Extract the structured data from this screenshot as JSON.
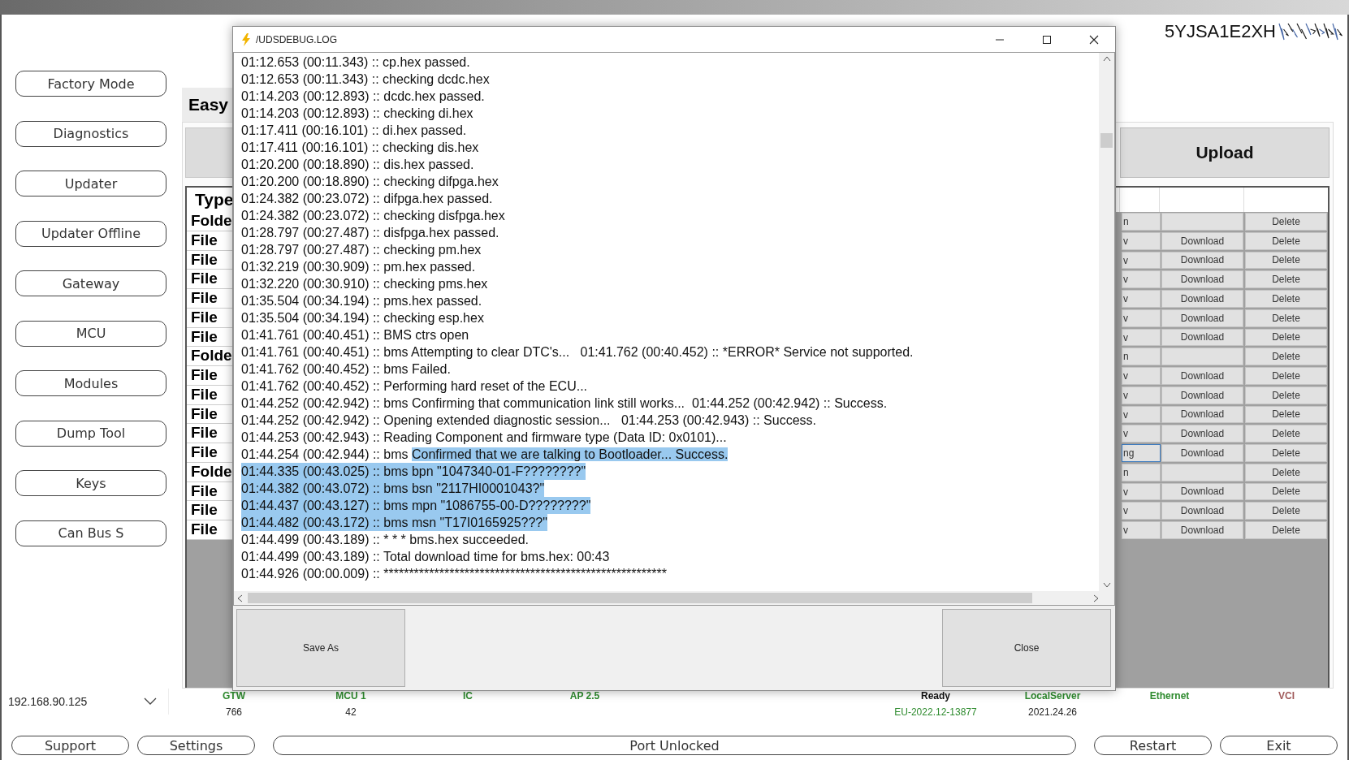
{
  "vin": "5YJSA1E2XH",
  "sidebar": {
    "buttons": [
      "Factory Mode",
      "Diagnostics",
      "Updater",
      "Updater Offline",
      "Gateway",
      "MCU",
      "Modules",
      "Dump Tool",
      "Keys",
      "Can Bus S"
    ]
  },
  "tab_label": "Easy",
  "upload_button": "Upload",
  "table": {
    "columns": [
      "Type"
    ],
    "rows": [
      {
        "column_1": "Folde",
        "column_2": "n",
        "column_4": "Delete",
        "selected": false
      },
      {
        "column_1": "File",
        "column_2": "v",
        "column_3": "Download",
        "column_4": "Delete",
        "selected": false
      },
      {
        "column_1": "File",
        "column_2": "v",
        "column_3": "Download",
        "column_4": "Delete",
        "selected": false
      },
      {
        "column_1": "File",
        "column_2": "v",
        "column_3": "Download",
        "column_4": "Delete",
        "selected": false
      },
      {
        "column_1": "File",
        "column_2": "v",
        "column_3": "Download",
        "column_4": "Delete",
        "selected": false
      },
      {
        "column_1": "File",
        "column_2": "v",
        "column_3": "Download",
        "column_4": "Delete",
        "selected": false
      },
      {
        "column_1": "File",
        "column_2": "v",
        "column_3": "Download",
        "column_4": "Delete",
        "selected": false
      },
      {
        "column_1": "Folde",
        "column_2": "n",
        "column_4": "Delete",
        "selected": false
      },
      {
        "column_1": "File",
        "column_2": "v",
        "column_3": "Download",
        "column_4": "Delete",
        "selected": false
      },
      {
        "column_1": "File",
        "column_2": "v",
        "column_3": "Download",
        "column_4": "Delete",
        "selected": false
      },
      {
        "column_1": "File",
        "column_2": "v",
        "column_3": "Download",
        "column_4": "Delete",
        "selected": false
      },
      {
        "column_1": "File",
        "column_2": "v",
        "column_3": "Download",
        "column_4": "Delete",
        "selected": false
      },
      {
        "column_1": "File",
        "column_2": "ng",
        "column_3": "Download",
        "column_4": "Delete",
        "selected": true
      },
      {
        "column_1": "Folde",
        "column_2": "n",
        "column_4": "Delete",
        "selected": false
      },
      {
        "column_1": "File",
        "column_2": "v",
        "column_3": "Download",
        "column_4": "Delete",
        "selected": false
      },
      {
        "column_1": "File",
        "column_2": "v",
        "column_3": "Download",
        "column_4": "Delete",
        "selected": false
      },
      {
        "column_1": "File",
        "column_2": "v",
        "column_3": "Download",
        "column_4": "Delete",
        "selected": false
      }
    ]
  },
  "dialog": {
    "title": "/UDSDEBUG.LOG",
    "lines": [
      {
        "text": "01:12.653 (00:11.343) :: cp.hex passed.",
        "selected": false
      },
      {
        "text": "01:12.653 (00:11.343) :: checking dcdc.hex",
        "selected": false
      },
      {
        "text": "01:14.203 (00:12.893) :: dcdc.hex passed.",
        "selected": false
      },
      {
        "text": "01:14.203 (00:12.893) :: checking di.hex",
        "selected": false
      },
      {
        "text": "01:17.411 (00:16.101) :: di.hex passed.",
        "selected": false
      },
      {
        "text": "01:17.411 (00:16.101) :: checking dis.hex",
        "selected": false
      },
      {
        "text": "01:20.200 (00:18.890) :: dis.hex passed.",
        "selected": false
      },
      {
        "text": "01:20.200 (00:18.890) :: checking difpga.hex",
        "selected": false
      },
      {
        "text": "01:24.382 (00:23.072) :: difpga.hex passed.",
        "selected": false
      },
      {
        "text": "01:24.382 (00:23.072) :: checking disfpga.hex",
        "selected": false
      },
      {
        "text": "01:28.797 (00:27.487) :: disfpga.hex passed.",
        "selected": false
      },
      {
        "text": "01:28.797 (00:27.487) :: checking pm.hex",
        "selected": false
      },
      {
        "text": "01:32.219 (00:30.909) :: pm.hex passed.",
        "selected": false
      },
      {
        "text": "01:32.220 (00:30.910) :: checking pms.hex",
        "selected": false
      },
      {
        "text": "01:35.504 (00:34.194) :: pms.hex passed.",
        "selected": false
      },
      {
        "text": "01:35.504 (00:34.194) :: checking esp.hex",
        "selected": false
      },
      {
        "text": "01:41.761 (00:40.451) :: BMS ctrs open",
        "selected": false
      },
      {
        "text": "01:41.761 (00:40.451) :: bms Attempting to clear DTC's...   01:41.762 (00:40.452) :: *ERROR* Service not supported.",
        "selected": false
      },
      {
        "text": "01:41.762 (00:40.452) :: bms Failed.",
        "selected": false
      },
      {
        "text": "01:41.762 (00:40.452) :: Performing hard reset of the ECU...",
        "selected": false
      },
      {
        "text": "01:44.252 (00:42.942) :: bms Confirming that communication link still works...  01:44.252 (00:42.942) :: Success.",
        "selected": false
      },
      {
        "text": "01:44.252 (00:42.942) :: Opening extended diagnostic session...   01:44.253 (00:42.943) :: Success.",
        "selected": false
      },
      {
        "text": "01:44.253 (00:42.943) :: Reading Component and firmware type (Data ID: 0x0101)...",
        "selected": false
      },
      {
        "text": "01:44.254 (00:42.944) :: bms ",
        "selected": false,
        "selected_text": "Confirmed that we are talking to Bootloader... Success."
      },
      {
        "text": "01:44.335 (00:43.025) :: bms bpn \"1047340-01-F????????\"",
        "selected": true
      },
      {
        "text": "01:44.382 (00:43.072) :: bms bsn \"2117HI0001043?\"",
        "selected": true
      },
      {
        "text": "01:44.437 (00:43.127) :: bms mpn \"1086755-00-D????????\"",
        "selected": true
      },
      {
        "text": "01:44.482 (00:43.172) :: bms msn \"T17I0165925???\"",
        "selected": true
      },
      {
        "text": "01:44.499 (00:43.189) :: * * * bms.hex succeeded.",
        "selected": false
      },
      {
        "text": "01:44.499 (00:43.189) :: Total download time for bms.hex: 00:43",
        "selected": false
      },
      {
        "text": "01:44.926 (00:00.009) :: ********************************************************",
        "selected": false
      }
    ],
    "buttons": [
      "Save As",
      "Close"
    ]
  },
  "status": {
    "address": "192.168.90.125",
    "items": [
      {
        "label": "GTW",
        "color": "#2e8b2e",
        "value": "766"
      },
      {
        "label": "MCU 1",
        "color": "#2e8b2e",
        "value": "42"
      },
      {
        "label": "IC",
        "color": "#2e8b2e"
      },
      {
        "label": "AP 2.5",
        "color": "#2e8b2e"
      },
      {
        "label": "Ready",
        "color": "#111111",
        "value": "EU-2022.12-13877"
      },
      {
        "label": "LocalServer",
        "color": "#2e8b2e",
        "value": "2021.24.26"
      },
      {
        "label": "Ethernet",
        "color": "#2e8b2e"
      },
      {
        "label": "VCI",
        "color": "#a05a5a"
      }
    ]
  },
  "footer_buttons": [
    "Support",
    "Settings",
    "Port Unlocked",
    "Restart",
    "Exit"
  ]
}
